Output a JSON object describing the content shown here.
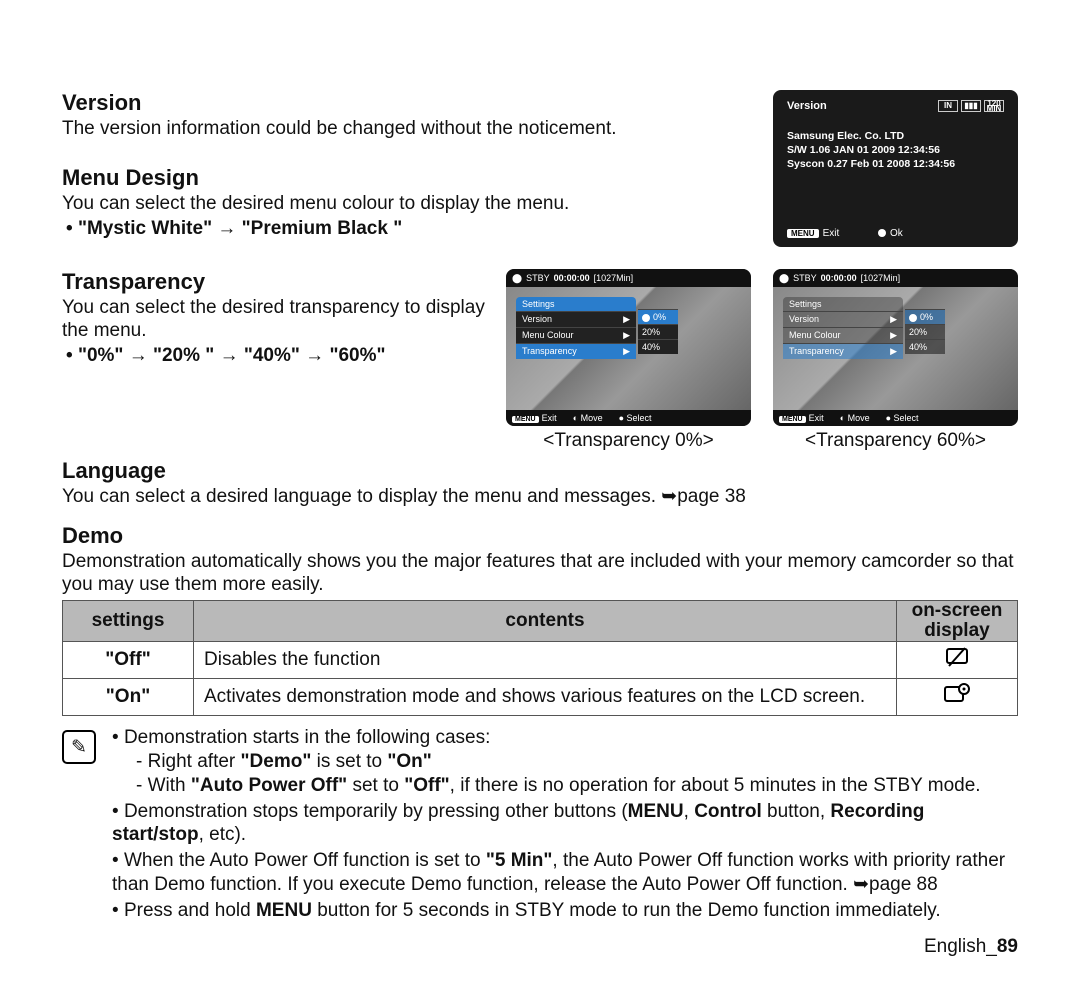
{
  "sections": {
    "version": {
      "title": "Version",
      "body": "The version information could be changed without the noticement."
    },
    "menuDesign": {
      "title": "Menu Design",
      "body": "You can select the desired menu colour to display the menu.",
      "bullet": "\"Mystic White\" → \"Premium Black \""
    },
    "transparency": {
      "title": "Transparency",
      "body": "You can select the desired transparency to display the menu.",
      "bullet": "\"0%\" → \"20% \" → \"40%\" → \"60%\""
    },
    "language": {
      "title": "Language",
      "body": "You can select a desired language to display the menu and messages. ",
      "pageRef": "page 38"
    },
    "demo": {
      "title": "Demo",
      "body": "Demonstration automatically shows you the major features that are included with your memory camcorder so that you may use them more easily."
    }
  },
  "lcd_version": {
    "title": "Version",
    "lines": [
      "Samsung Elec. Co. LTD",
      "S/W 1.06 JAN 01 2009 12:34:56",
      "Syscon 0.27 Feb 01 2008 12:34:56"
    ],
    "foot_exit_badge": "MENU",
    "foot_exit": "Exit",
    "foot_ok": "Ok",
    "icon_min": "120\nMIN"
  },
  "lcd_transparency": {
    "top_stby": "STBY",
    "top_time": "00:00:00",
    "top_remain": "[1027Min]",
    "menu_header": "Settings",
    "rows": [
      "Version",
      "Menu Colour",
      "Transparency"
    ],
    "submenu": [
      "0%",
      "20%",
      "40%"
    ],
    "foot_exit_badge": "MENU",
    "foot_exit": "Exit",
    "foot_move": "Move",
    "foot_select": "Select",
    "caption0": "<Transparency 0%>",
    "caption60": "<Transparency 60%>"
  },
  "demoTable": {
    "headers": {
      "c1": "settings",
      "c2": "contents",
      "c3": "on-screen display"
    },
    "rows": [
      {
        "c1": "\"Off\"",
        "c2": "Disables the function",
        "icon": "⌀"
      },
      {
        "c1": "\"On\"",
        "c2": "Activates demonstration mode and shows various features on the LCD screen.",
        "icon": "▣"
      }
    ]
  },
  "notes": {
    "n1": "Demonstration starts in the following cases:",
    "n1a_pre": "Right after ",
    "n1a_b1": "\"Demo\"",
    "n1a_mid": " is set to ",
    "n1a_b2": "\"On\"",
    "n1b_pre": "With ",
    "n1b_b1": "\"Auto Power Off\"",
    "n1b_mid": " set to ",
    "n1b_b2": "\"Off\"",
    "n1b_post": ", if there is no operation for about 5 minutes in the STBY mode.",
    "n2_pre": "Demonstration stops temporarily by pressing other buttons (",
    "n2_b1": "MENU",
    "n2_mid1": ", ",
    "n2_b2": "Control",
    "n2_mid2": " button, ",
    "n2_b3": "Recording start/stop",
    "n2_post": ", etc).",
    "n3_pre": "When the Auto Power Off function is set to ",
    "n3_b1": "\"5 Min\"",
    "n3_post": ", the Auto Power Off function works with priority rather than Demo function. If you execute Demo function, release the Auto Power Off function. ",
    "n3_page": "page 88",
    "n4_pre": "Press and hold ",
    "n4_b1": "MENU",
    "n4_post": " button for 5 seconds in STBY mode to run the Demo function immediately."
  },
  "footer": {
    "lang": "English_",
    "page": "89"
  }
}
